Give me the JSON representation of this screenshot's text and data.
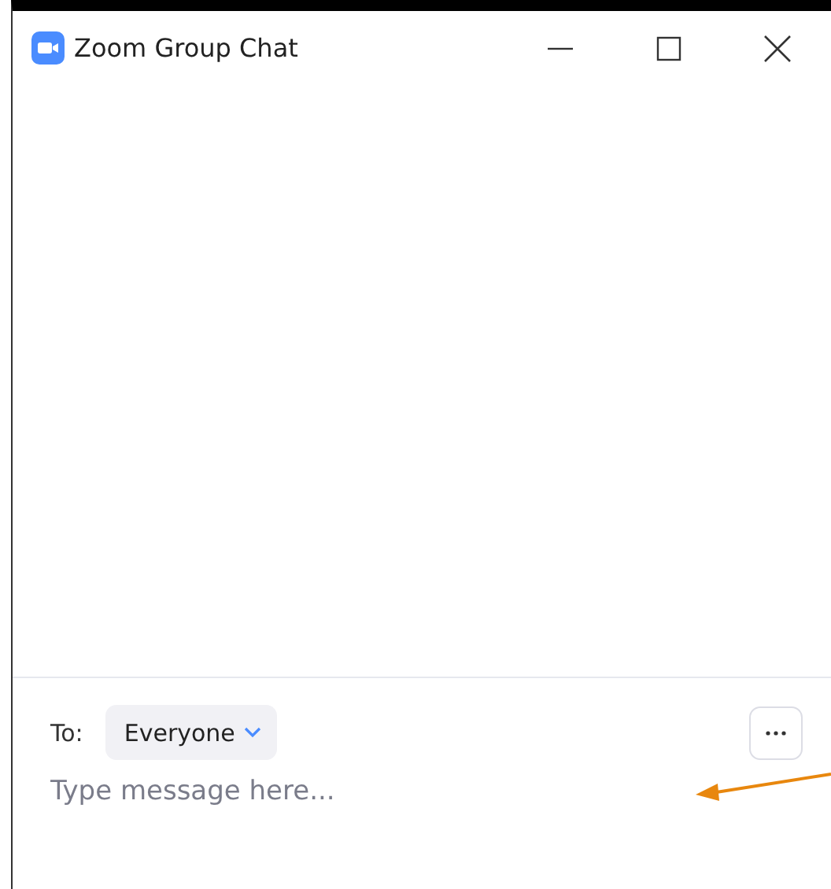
{
  "window": {
    "title": "Zoom Group Chat"
  },
  "composer": {
    "to_label": "To:",
    "recipient": "Everyone",
    "placeholder": "Type message here..."
  }
}
